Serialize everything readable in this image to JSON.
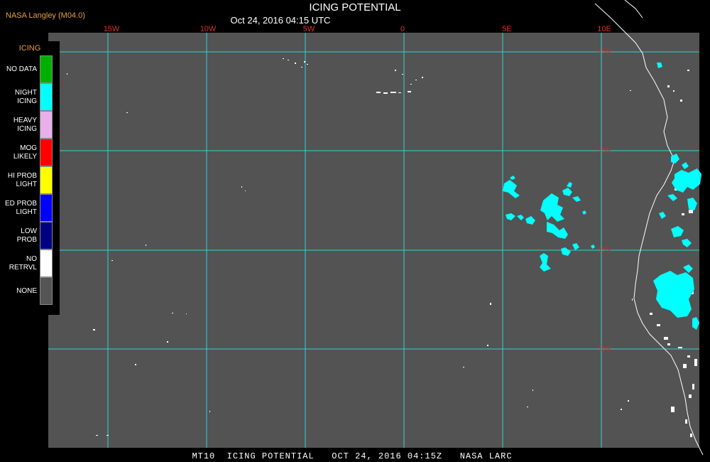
{
  "header": {
    "credit": "NASA Langley (M04.0)",
    "title": "ICING POTENTIAL",
    "subtitle": "Oct 24, 2016 04:15 UTC"
  },
  "map": {
    "background_color": "#535353",
    "grid_color": "#2fd3d3",
    "coast_color": "#ffffff",
    "lon_labels": [
      "15W",
      "10W",
      "5W",
      "0",
      "5E",
      "10E"
    ],
    "lat_labels": [
      "45N",
      "40N",
      "35N",
      "30N"
    ]
  },
  "legend": {
    "title": "ICING",
    "items": [
      {
        "label": "NO DATA",
        "color": "#00b000"
      },
      {
        "label": "NIGHT\nICING",
        "color": "#00ffff"
      },
      {
        "label": "HEAVY\nICING",
        "color": "#e8b0e8"
      },
      {
        "label": "MOG\nLIKELY",
        "color": "#ff0000"
      },
      {
        "label": "HI PROB\nLIGHT",
        "color": "#ffff00"
      },
      {
        "label": "ED PROB\nLIGHT",
        "color": "#0000ff"
      },
      {
        "label": "LOW\nPROB",
        "color": "#000080"
      },
      {
        "label": "NO\nRETRVL",
        "color": "#ffffff"
      },
      {
        "label": "NONE",
        "color": "#555555"
      }
    ]
  },
  "footer": {
    "text": "MT10  ICING POTENTIAL   OCT 24, 2016 04:15Z   NASA LARC"
  }
}
